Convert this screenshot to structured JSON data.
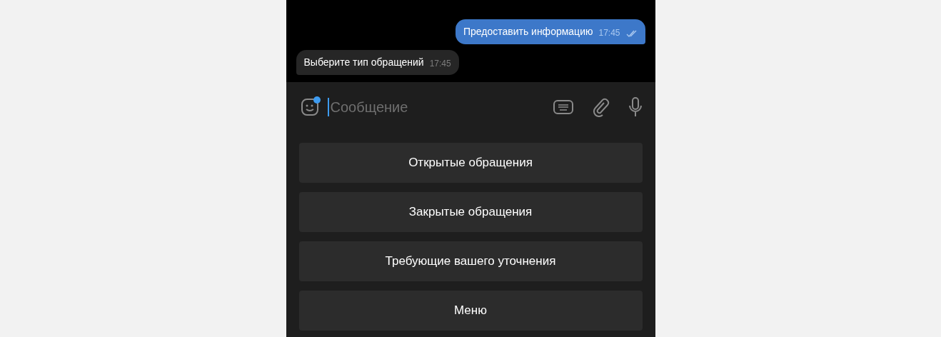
{
  "messages": [
    {
      "kind": "outgoing",
      "text": "Предоставить информацию",
      "time": "17:45",
      "read": true
    },
    {
      "kind": "incoming",
      "text": "Выберите тип обращений",
      "time": "17:45"
    }
  ],
  "composer": {
    "placeholder": "Сообщение"
  },
  "keyboard_buttons": [
    "Открытые обращения",
    "Закрытые обращения",
    "Требующие вашего уточнения",
    "Меню"
  ]
}
